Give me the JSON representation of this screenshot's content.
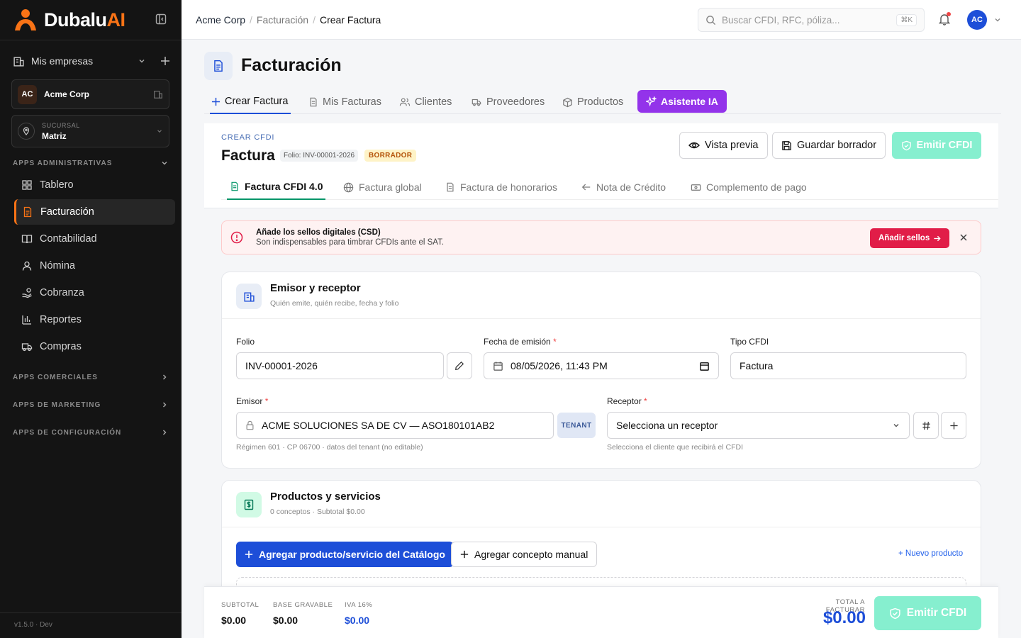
{
  "brand": {
    "name_main": "Dubalu",
    "name_accent": "AI"
  },
  "sidebar": {
    "mis_empresas": "Mis empresas",
    "company": {
      "initials": "AC",
      "name": "Acme Corp"
    },
    "sucursal": {
      "label": "SUCURSAL",
      "value": "Matriz"
    },
    "sections": {
      "admin": "APPS ADMINISTRATIVAS",
      "comerciales": "APPS COMERCIALES",
      "marketing": "APPS DE MARKETING",
      "config": "APPS DE CONFIGURACIÓN"
    },
    "items": [
      {
        "label": "Tablero",
        "icon": "grid-icon"
      },
      {
        "label": "Facturación",
        "icon": "document-icon",
        "active": true
      },
      {
        "label": "Contabilidad",
        "icon": "book-icon"
      },
      {
        "label": "Nómina",
        "icon": "user-icon"
      },
      {
        "label": "Cobranza",
        "icon": "hand-coins-icon"
      },
      {
        "label": "Reportes",
        "icon": "bar-chart-icon"
      },
      {
        "label": "Compras",
        "icon": "truck-icon"
      }
    ],
    "version": "v1.5.0 · Dev"
  },
  "topbar": {
    "breadcrumb": [
      "Acme Corp",
      "Facturación",
      "Crear Factura"
    ],
    "search_placeholder": "Buscar CFDI, RFC, póliza...",
    "search_shortcut": "⌘K",
    "user_initials": "AC"
  },
  "page": {
    "title": "Facturación",
    "tabs": [
      "Crear Factura",
      "Mis Facturas",
      "Clientes",
      "Proveedores",
      "Productos"
    ],
    "ai_tab": "Asistente IA"
  },
  "invoice": {
    "kicker": "CREAR CFDI",
    "title": "Factura",
    "folio_chip": "Folio: INV-00001-2026",
    "status": "BORRADOR",
    "actions": {
      "preview": "Vista previa",
      "save": "Guardar borrador",
      "emit": "Emitir CFDI"
    },
    "subtabs": [
      "Factura CFDI 4.0",
      "Factura global",
      "Factura de honorarios",
      "Nota de Crédito",
      "Complemento de pago"
    ]
  },
  "alert": {
    "title": "Añade los sellos digitales (CSD)",
    "body": "Son indispensables para timbrar CFDIs ante el SAT.",
    "action": "Añadir sellos"
  },
  "emisor_card": {
    "title": "Emisor y receptor",
    "subtitle": "Quién emite, quién recibe, fecha y folio",
    "folio_label": "Folio",
    "folio_value": "INV-00001-2026",
    "fecha_label": "Fecha de emisión",
    "fecha_value": "08/05/2026, 11:43 PM",
    "tipo_label": "Tipo CFDI",
    "tipo_value": "Factura",
    "emisor_label": "Emisor",
    "emisor_value": "ACME SOLUCIONES SA DE CV — ASO180101AB2",
    "tenant_chip": "TENANT",
    "emisor_hint": "Régimen 601 · CP 06700 · datos del tenant (no editable)",
    "receptor_label": "Receptor",
    "receptor_placeholder": "Selecciona un receptor",
    "receptor_hint": "Selecciona el cliente que recibirá el CFDI",
    "required_mark": "*"
  },
  "productos_card": {
    "title": "Productos y servicios",
    "subtitle": "0 conceptos · Subtotal $0.00",
    "add_catalog": "Agregar producto/servicio del Catálogo",
    "add_manual": "Agregar concepto manual",
    "new_product": "+ Nuevo producto"
  },
  "footer": {
    "subtotal_label": "SUBTOTAL",
    "subtotal": "$0.00",
    "base_label": "BASE GRAVABLE",
    "base": "$0.00",
    "iva_label": "IVA 16%",
    "iva": "$0.00",
    "total_label": "TOTAL A FACTURAR",
    "total": "$0.00",
    "emit": "Emitir CFDI"
  },
  "colors": {
    "accent": "#f97316",
    "primary": "#1d4ed8",
    "ai": "#9333ea",
    "emit": "#86efcf",
    "danger": "#e11d48"
  }
}
